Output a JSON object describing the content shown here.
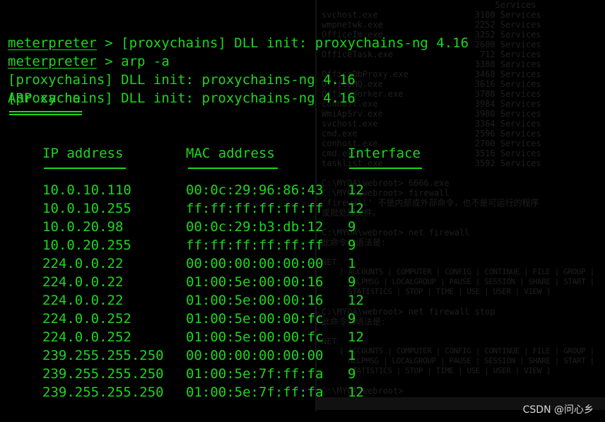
{
  "terminal": {
    "prompt": "meterpreter",
    "lines": [
      {
        "prompt": "meterpreter",
        "text": " > [proxychains] DLL init: proxychains-ng 4.16"
      },
      {
        "prompt": "meterpreter",
        "text": " > arp -a"
      },
      {
        "prompt": "",
        "text": "[proxychains] DLL init: proxychains-ng 4.16"
      },
      {
        "prompt": "",
        "text": "[proxychains] DLL init: proxychains-ng 4.16"
      }
    ],
    "arp_title": "ARP cache",
    "headers": {
      "ip": "IP address",
      "mac": "MAC address",
      "iface": "Interface"
    },
    "rows": [
      {
        "ip": "10.0.10.110",
        "mac": "00:0c:29:96:86:43",
        "iface": "12"
      },
      {
        "ip": "10.0.10.255",
        "mac": "ff:ff:ff:ff:ff:ff",
        "iface": "12"
      },
      {
        "ip": "10.0.20.98",
        "mac": "00:0c:29:b3:db:12",
        "iface": "9"
      },
      {
        "ip": "10.0.20.255",
        "mac": "ff:ff:ff:ff:ff:ff",
        "iface": "9"
      },
      {
        "ip": "224.0.0.22",
        "mac": "00:00:00:00:00:00",
        "iface": "1"
      },
      {
        "ip": "224.0.0.22",
        "mac": "01:00:5e:00:00:16",
        "iface": "9"
      },
      {
        "ip": "224.0.0.22",
        "mac": "01:00:5e:00:00:16",
        "iface": "12"
      },
      {
        "ip": "224.0.0.252",
        "mac": "01:00:5e:00:00:fc",
        "iface": "9"
      },
      {
        "ip": "224.0.0.252",
        "mac": "01:00:5e:00:00:fc",
        "iface": "12"
      },
      {
        "ip": "239.255.255.250",
        "mac": "00:00:00:00:00:00",
        "iface": "1"
      },
      {
        "ip": "239.255.255.250",
        "mac": "01:00:5e:7f:ff:fa",
        "iface": "9"
      },
      {
        "ip": "239.255.255.250",
        "mac": "01:00:5e:7f:ff:fa",
        "iface": "12"
      }
    ]
  },
  "background_window": {
    "lines": [
      "                                  Services",
      "svchost.exe                   3100 Services",
      "wmpnetwk.exe                  2252 Services",
      "OfficeIm.exe                  3252 Services",
      "                              2600 Services",
      "OfficeTask.exe                 712 Services",
      "                              3388 Services",
      "OfficeDbProxy.exe             3468 Services",
      "OfficeMQ.exe                  3616 Services",
      "OfficeWorker.exe              3788 Services",
      "conhost.exe                   3984 Services",
      "WmiApSrv.exe                  3980 Services",
      "svchost.exe                   3364 Services",
      "cmd.exe                       2596 Services",
      "conhost.exe                   2700 Services",
      "cmd.exe                       3516 Services",
      "tasklist.exe                  3592 Services",
      "",
      "C:\\MYOA\\webroot> 6666.exe",
      "C:\\MYOA\\webroot> firewall",
      "'firewall' 不是内部或外部命令，也不是可运行的程序",
      "或批处理文件。",
      "",
      "C:\\MYOA\\webroot> net firewall",
      "此命令的语法是:",
      "",
      "NET",
      "    [ ACCOUNTS | COMPUTER | CONFIG | CONTINUE | FILE | GROUP |",
      "      HELPMSG | LOCALGROUP | PAUSE | SESSION | SHARE | START |",
      "      STATISTICS | STOP | TIME | USE | USER | VIEW ]",
      "",
      "C:\\MYOA\\webroot> net firewall stop",
      "此命令的语法是:",
      "",
      "NET",
      "    [ ACCOUNTS | COMPUTER | CONFIG | CONTINUE | FILE | GROUP |",
      "      HELPMSG | LOCALGROUP | PAUSE | SESSION | SHARE | START |",
      "      STATISTICS | STOP | TIME | USE | USER | VIEW ]",
      "",
      "C:\\MYOA\\webroot>"
    ]
  },
  "watermark": "CSDN @问心乡",
  "colors": {
    "terminal_text": "#1fd51f",
    "background": "#000000"
  }
}
